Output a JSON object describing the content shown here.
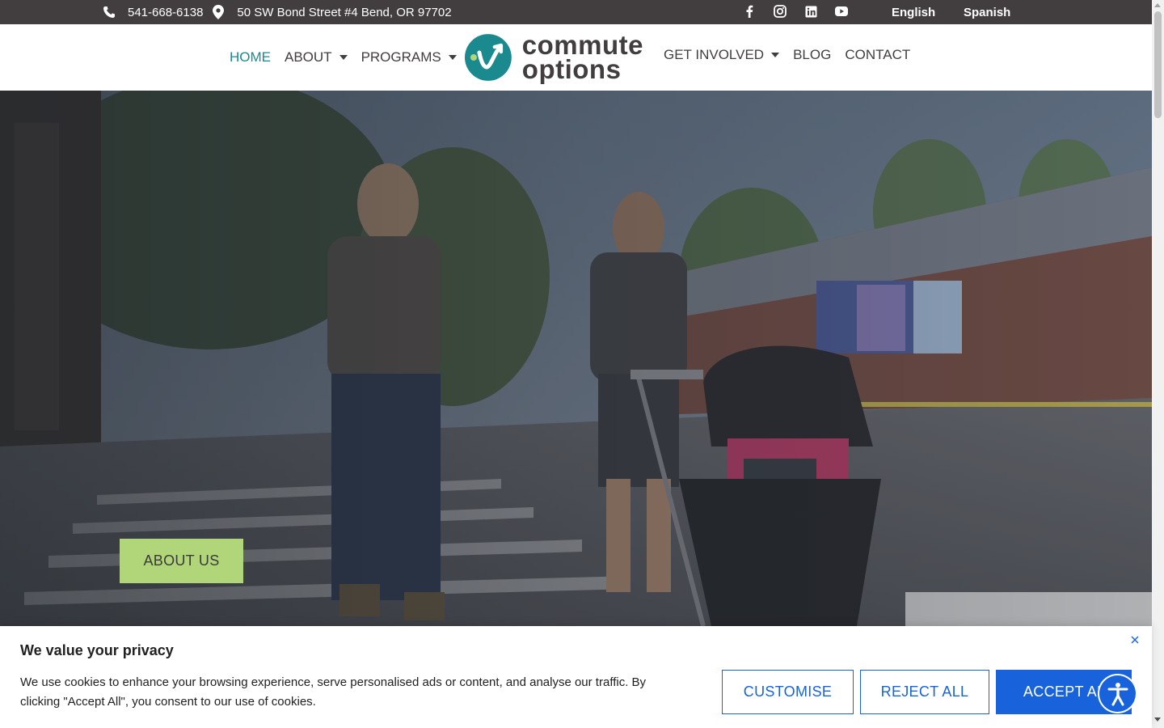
{
  "topbar": {
    "phone": "541-668-6138",
    "address": "50 SW Bond Street #4 Bend, OR 97702",
    "social_icons": [
      "facebook-icon",
      "instagram-icon",
      "linkedin-icon",
      "youtube-icon"
    ],
    "languages": [
      "English",
      "Spanish"
    ]
  },
  "nav": {
    "home": "HOME",
    "about": "ABOUT",
    "programs": "PROGRAMS",
    "get_involved": "GET INVOLVED",
    "blog": "BLOG",
    "contact": "CONTACT",
    "active": "HOME"
  },
  "logo": {
    "line1": "commute",
    "line2": "options"
  },
  "hero": {
    "button_label": "ABOUT US"
  },
  "cookie": {
    "title": "We value your privacy",
    "text": "We use cookies to enhance your browsing experience, serve personalised ads or content, and analyse our traffic. By clicking \"Accept All\", you consent to our use of cookies.",
    "customise": "CUSTOMISE",
    "reject": "REJECT ALL",
    "accept": "ACCEPT ALL"
  },
  "colors": {
    "topbar_bg": "#423d3e",
    "brand_teal": "#1a8a8f",
    "hero_button": "#b1d67a",
    "cookie_blue": "#1863dc"
  }
}
